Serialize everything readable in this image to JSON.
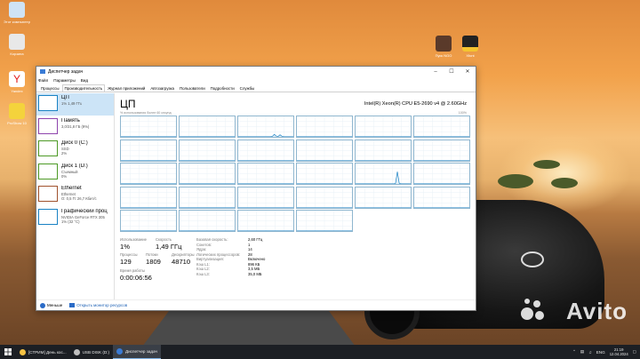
{
  "desktop": {
    "icons": [
      {
        "label": "Этот компьютер"
      },
      {
        "label": "Корзина"
      },
      {
        "label": "Yandex"
      },
      {
        "label": "ProShow 10"
      },
      {
        "label": "Пуск NGO"
      },
      {
        "label": "Xfont"
      }
    ],
    "watermark": "Avito"
  },
  "window": {
    "title": "Диспетчер задач",
    "menu": [
      "Файл",
      "Параметры",
      "Вид"
    ],
    "tabs": [
      "Процессы",
      "Производительность",
      "Журнал приложений",
      "Автозагрузка",
      "Пользователи",
      "Подробности",
      "Службы"
    ],
    "active_tab": 1,
    "left_items": [
      {
        "name": "ЦП",
        "line1": "1% 1,49 ГГц",
        "line2": "",
        "color": "#1982c4"
      },
      {
        "name": "Память",
        "line1": "3,0/31,8 ГБ (9%)",
        "line2": "",
        "color": "#8e44ad"
      },
      {
        "name": "Диск 0 (C:)",
        "line1": "SSD",
        "line2": "2%",
        "color": "#4d9a26"
      },
      {
        "name": "Диск 1 (D:)",
        "line1": "Съемный",
        "line2": "0%",
        "color": "#4d9a26"
      },
      {
        "name": "Ethernet",
        "line1": "Ethernet",
        "line2": "О: 0,5 П: 26,7 Кбит/с",
        "color": "#a0522d"
      },
      {
        "name": "Графический проц",
        "line1": "NVIDIA GeForce RTX 305",
        "line2": "1% (32 °C)",
        "color": "#1982c4"
      }
    ],
    "cpu": {
      "title": "ЦП",
      "model": "Intel(R) Xeon(R) CPU E5-2690 v4 @ 2.60GHz",
      "util_label": "% использования более 60 секунд",
      "util_max": "100%"
    },
    "stats": {
      "usage_label": "Использование",
      "usage_value": "1%",
      "speed_label": "Скорость",
      "speed_value": "1,49 ГГц",
      "processes_label": "Процессы",
      "processes_value": "129",
      "threads_label": "Потоки",
      "threads_value": "1809",
      "handles_label": "Дескрипторы",
      "handles_value": "48710",
      "uptime_label": "Время работы",
      "uptime_value": "0:00:06:56"
    },
    "specs": [
      {
        "k": "Базовая скорость:",
        "v": "2,60 ГГц"
      },
      {
        "k": "Сокетов:",
        "v": "1"
      },
      {
        "k": "Ядра:",
        "v": "14"
      },
      {
        "k": "Логических процессоров:",
        "v": "28"
      },
      {
        "k": "Виртуализация:",
        "v": "Включено"
      },
      {
        "k": "Кэш L1:",
        "v": "896 КБ"
      },
      {
        "k": "Кэш L2:",
        "v": "3,5 МБ"
      },
      {
        "k": "Кэш L3:",
        "v": "35,0 МБ"
      }
    ],
    "footer": {
      "less": "Меньше",
      "monitor": "Открыть монитор ресурсов"
    }
  },
  "taskbar": {
    "items": [
      {
        "label": "[СТРИМ] День кос...",
        "icon_color": "#f6c344"
      },
      {
        "label": "USB DISK (D:)",
        "icon_color": "#c0c0c0"
      },
      {
        "label": "Диспетчер задач",
        "icon_color": "#3a7bd5"
      }
    ],
    "active_item": 2,
    "lang": "ENG",
    "time": "21:19",
    "date": "12.04.2024"
  },
  "chart_data": {
    "type": "line",
    "title": "ЦП",
    "ylabel": "% использования более 60 секунд",
    "ylim": [
      0,
      100
    ],
    "cores": 28,
    "series": [
      {
        "values": [
          1,
          1,
          1,
          1,
          1,
          1,
          1,
          1,
          1,
          1,
          1,
          1,
          1,
          1,
          1,
          1,
          1,
          1,
          1,
          1,
          1,
          1,
          1,
          1,
          1,
          1,
          1,
          1,
          1,
          1
        ]
      },
      {
        "values": [
          1,
          1,
          1,
          1,
          1,
          1,
          1,
          1,
          1,
          1,
          1,
          1,
          1,
          1,
          1,
          1,
          1,
          1,
          1,
          1,
          1,
          1,
          1,
          1,
          1,
          1,
          1,
          1,
          1,
          1
        ]
      },
      {
        "values": [
          1,
          1,
          1,
          1,
          1,
          1,
          1,
          1,
          1,
          1,
          1,
          1,
          1,
          1,
          1,
          1,
          1,
          1,
          3,
          12,
          4,
          2,
          10,
          3,
          1,
          1,
          1,
          1,
          1,
          1
        ]
      },
      {
        "values": [
          1,
          1,
          1,
          1,
          1,
          1,
          1,
          1,
          1,
          1,
          1,
          1,
          1,
          1,
          1,
          1,
          1,
          1,
          1,
          1,
          1,
          1,
          1,
          1,
          1,
          1,
          1,
          1,
          1,
          1
        ]
      },
      {
        "values": [
          1,
          1,
          1,
          1,
          1,
          1,
          1,
          1,
          1,
          1,
          1,
          1,
          1,
          1,
          1,
          1,
          1,
          1,
          1,
          1,
          1,
          1,
          1,
          1,
          1,
          1,
          1,
          1,
          1,
          1
        ]
      },
      {
        "values": [
          1,
          1,
          1,
          1,
          1,
          1,
          1,
          1,
          1,
          1,
          1,
          1,
          1,
          1,
          1,
          1,
          1,
          1,
          1,
          1,
          1,
          1,
          1,
          1,
          1,
          1,
          1,
          1,
          1,
          1
        ]
      },
      {
        "values": [
          1,
          1,
          1,
          1,
          1,
          1,
          1,
          1,
          1,
          1,
          1,
          1,
          1,
          1,
          1,
          1,
          1,
          1,
          1,
          1,
          1,
          1,
          1,
          1,
          1,
          1,
          1,
          1,
          1,
          1
        ]
      },
      {
        "values": [
          1,
          1,
          1,
          1,
          1,
          1,
          1,
          1,
          1,
          1,
          1,
          1,
          1,
          1,
          1,
          1,
          1,
          1,
          1,
          1,
          1,
          1,
          1,
          1,
          1,
          1,
          1,
          1,
          1,
          1
        ]
      },
      {
        "values": [
          1,
          1,
          1,
          1,
          1,
          1,
          1,
          1,
          1,
          1,
          1,
          1,
          1,
          1,
          1,
          1,
          1,
          1,
          1,
          1,
          1,
          1,
          1,
          1,
          1,
          1,
          1,
          1,
          1,
          1
        ]
      },
      {
        "values": [
          1,
          1,
          1,
          1,
          1,
          1,
          1,
          1,
          1,
          1,
          1,
          1,
          1,
          1,
          1,
          1,
          1,
          1,
          1,
          1,
          1,
          1,
          1,
          1,
          1,
          1,
          1,
          1,
          1,
          1
        ]
      },
      {
        "values": [
          1,
          1,
          1,
          1,
          1,
          1,
          1,
          1,
          1,
          1,
          1,
          1,
          1,
          1,
          1,
          1,
          1,
          1,
          1,
          1,
          1,
          1,
          1,
          1,
          1,
          1,
          1,
          1,
          1,
          1
        ]
      },
      {
        "values": [
          1,
          1,
          1,
          1,
          1,
          1,
          1,
          1,
          1,
          1,
          1,
          1,
          1,
          1,
          1,
          1,
          1,
          1,
          1,
          1,
          1,
          1,
          1,
          1,
          1,
          1,
          1,
          1,
          1,
          1
        ]
      },
      {
        "values": [
          1,
          1,
          1,
          1,
          1,
          1,
          1,
          1,
          1,
          1,
          1,
          1,
          1,
          1,
          1,
          1,
          1,
          1,
          1,
          1,
          1,
          1,
          1,
          1,
          1,
          1,
          1,
          1,
          1,
          1
        ]
      },
      {
        "values": [
          1,
          1,
          1,
          1,
          1,
          1,
          1,
          1,
          1,
          1,
          1,
          1,
          1,
          1,
          1,
          1,
          1,
          1,
          1,
          1,
          1,
          1,
          1,
          1,
          1,
          1,
          1,
          1,
          1,
          1
        ]
      },
      {
        "values": [
          1,
          1,
          1,
          1,
          1,
          1,
          1,
          1,
          1,
          1,
          1,
          1,
          1,
          1,
          1,
          1,
          1,
          1,
          1,
          1,
          1,
          1,
          1,
          1,
          1,
          1,
          1,
          1,
          1,
          1
        ]
      },
      {
        "values": [
          1,
          1,
          1,
          1,
          1,
          1,
          1,
          1,
          1,
          1,
          1,
          1,
          1,
          1,
          1,
          1,
          1,
          1,
          1,
          1,
          1,
          1,
          1,
          1,
          1,
          1,
          1,
          1,
          1,
          1
        ]
      },
      {
        "values": [
          1,
          1,
          1,
          1,
          1,
          1,
          1,
          1,
          1,
          1,
          1,
          1,
          1,
          1,
          1,
          1,
          1,
          1,
          1,
          1,
          1,
          2,
          60,
          3,
          1,
          1,
          1,
          1,
          1,
          1
        ]
      },
      {
        "values": [
          1,
          1,
          1,
          1,
          1,
          1,
          1,
          1,
          1,
          1,
          1,
          1,
          1,
          1,
          1,
          1,
          1,
          1,
          1,
          1,
          1,
          1,
          1,
          1,
          1,
          1,
          1,
          1,
          1,
          1
        ]
      },
      {
        "values": [
          1,
          1,
          1,
          1,
          1,
          1,
          1,
          1,
          1,
          1,
          1,
          1,
          1,
          1,
          1,
          1,
          1,
          1,
          1,
          1,
          1,
          1,
          1,
          1,
          1,
          1,
          1,
          1,
          1,
          1
        ]
      },
      {
        "values": [
          1,
          1,
          1,
          1,
          1,
          1,
          1,
          1,
          1,
          1,
          1,
          1,
          1,
          1,
          1,
          1,
          1,
          1,
          1,
          1,
          1,
          1,
          1,
          1,
          1,
          1,
          1,
          1,
          1,
          1
        ]
      },
      {
        "values": [
          1,
          1,
          1,
          1,
          1,
          1,
          1,
          1,
          1,
          1,
          1,
          1,
          1,
          1,
          1,
          1,
          1,
          1,
          1,
          1,
          1,
          1,
          1,
          1,
          1,
          1,
          1,
          1,
          1,
          1
        ]
      },
      {
        "values": [
          1,
          1,
          1,
          1,
          1,
          1,
          1,
          1,
          1,
          1,
          1,
          1,
          1,
          1,
          1,
          1,
          1,
          1,
          1,
          1,
          1,
          1,
          1,
          1,
          1,
          1,
          1,
          1,
          1,
          1
        ]
      },
      {
        "values": [
          1,
          1,
          1,
          1,
          1,
          1,
          1,
          1,
          1,
          1,
          1,
          1,
          1,
          1,
          1,
          1,
          1,
          1,
          1,
          1,
          1,
          1,
          1,
          1,
          1,
          1,
          1,
          1,
          1,
          1
        ]
      },
      {
        "values": [
          1,
          1,
          1,
          1,
          1,
          1,
          1,
          1,
          1,
          1,
          1,
          1,
          1,
          1,
          1,
          1,
          1,
          1,
          1,
          1,
          1,
          1,
          1,
          1,
          1,
          1,
          1,
          1,
          1,
          1
        ]
      },
      {
        "values": [
          1,
          1,
          1,
          1,
          1,
          1,
          1,
          1,
          1,
          1,
          1,
          1,
          1,
          1,
          1,
          1,
          1,
          1,
          1,
          1,
          1,
          1,
          1,
          1,
          1,
          1,
          1,
          1,
          1,
          1
        ]
      },
      {
        "values": [
          1,
          1,
          1,
          1,
          1,
          1,
          1,
          1,
          1,
          1,
          1,
          1,
          1,
          1,
          1,
          1,
          1,
          1,
          1,
          1,
          1,
          1,
          1,
          1,
          1,
          1,
          1,
          1,
          1,
          1
        ]
      },
      {
        "values": [
          1,
          1,
          1,
          1,
          1,
          1,
          1,
          1,
          1,
          1,
          1,
          1,
          1,
          1,
          1,
          1,
          1,
          1,
          1,
          1,
          1,
          1,
          1,
          1,
          1,
          1,
          1,
          1,
          1,
          1
        ]
      },
      {
        "values": [
          1,
          1,
          1,
          1,
          1,
          1,
          1,
          1,
          1,
          1,
          1,
          1,
          1,
          1,
          1,
          1,
          1,
          1,
          1,
          1,
          1,
          1,
          1,
          1,
          1,
          1,
          1,
          1,
          1,
          1
        ]
      }
    ]
  }
}
